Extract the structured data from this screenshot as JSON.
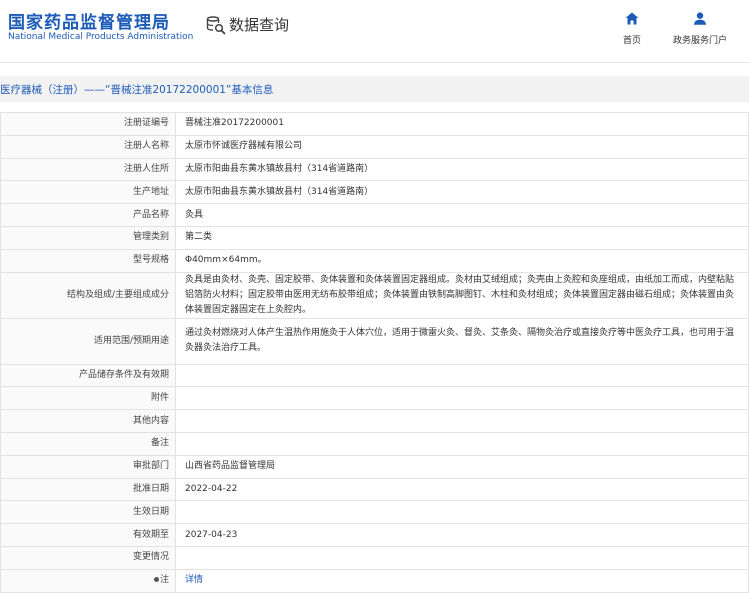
{
  "header": {
    "logo_cn": "国家药品监督管理局",
    "logo_en": "National Medical Products Administration",
    "query_icon": "database-search-icon",
    "query_label": "数据查询",
    "nav": [
      {
        "label": "首页",
        "icon": "home-icon"
      },
      {
        "label": "政务服务门户",
        "icon": "user-icon"
      }
    ]
  },
  "page_title": "医疗器械（注册）——“晋械注准20172200001”基本信息",
  "rows": [
    {
      "label": "注册证编号",
      "value": "晋械注准20172200001"
    },
    {
      "label": "注册人名称",
      "value": "太原市怀诚医疗器械有限公司"
    },
    {
      "label": "注册人住所",
      "value": "太原市阳曲县东黄水镇故县村（314省道路南）"
    },
    {
      "label": "生产地址",
      "value": "太原市阳曲县东黄水镇故县村（314省道路南）"
    },
    {
      "label": "产品名称",
      "value": "灸具"
    },
    {
      "label": "管理类别",
      "value": "第二类"
    },
    {
      "label": "型号规格",
      "value": "Φ40mm×64mm。"
    },
    {
      "label": "结构及组成/主要组成成分",
      "value": "灸具是由灸材、灸壳、固定胶带、灸体装置和灸体装置固定器组成。灸材由艾绒组成；灸壳由上灸腔和灸座组成，由纸加工而成，内壁粘贴铝箔防火材料；固定胶带由医用无纺布胶带组成；灸体装置由铁制高脚图钉、木柱和灸材组成；灸体装置固定器由磁石组成；灸体装置由灸体装置固定器固定在上灸腔内。"
    },
    {
      "label": "适用范围/预期用途",
      "value": "通过灸材燃烧对人体产生温热作用施灸于人体穴位，适用于微雷火灸、督灸、艾条灸、隔物灸治疗或直接灸疗等中医灸疗工具，也可用于温灸器灸法治疗工具。"
    },
    {
      "label": "产品储存条件及有效期",
      "value": ""
    },
    {
      "label": "附件",
      "value": ""
    },
    {
      "label": "其他内容",
      "value": ""
    },
    {
      "label": "备注",
      "value": ""
    },
    {
      "label": "审批部门",
      "value": "山西省药品监督管理局"
    },
    {
      "label": "批准日期",
      "value": "2022-04-22"
    },
    {
      "label": "生效日期",
      "value": ""
    },
    {
      "label": "有效期至",
      "value": "2027-04-23"
    },
    {
      "label": "变更情况",
      "value": ""
    },
    {
      "label": "注",
      "value": "详情"
    }
  ],
  "colors": {
    "brand": "#1c5bb8",
    "label_bg": "#fafafa",
    "border": "#e2e2e2",
    "title_bg": "#f2f2f2"
  }
}
